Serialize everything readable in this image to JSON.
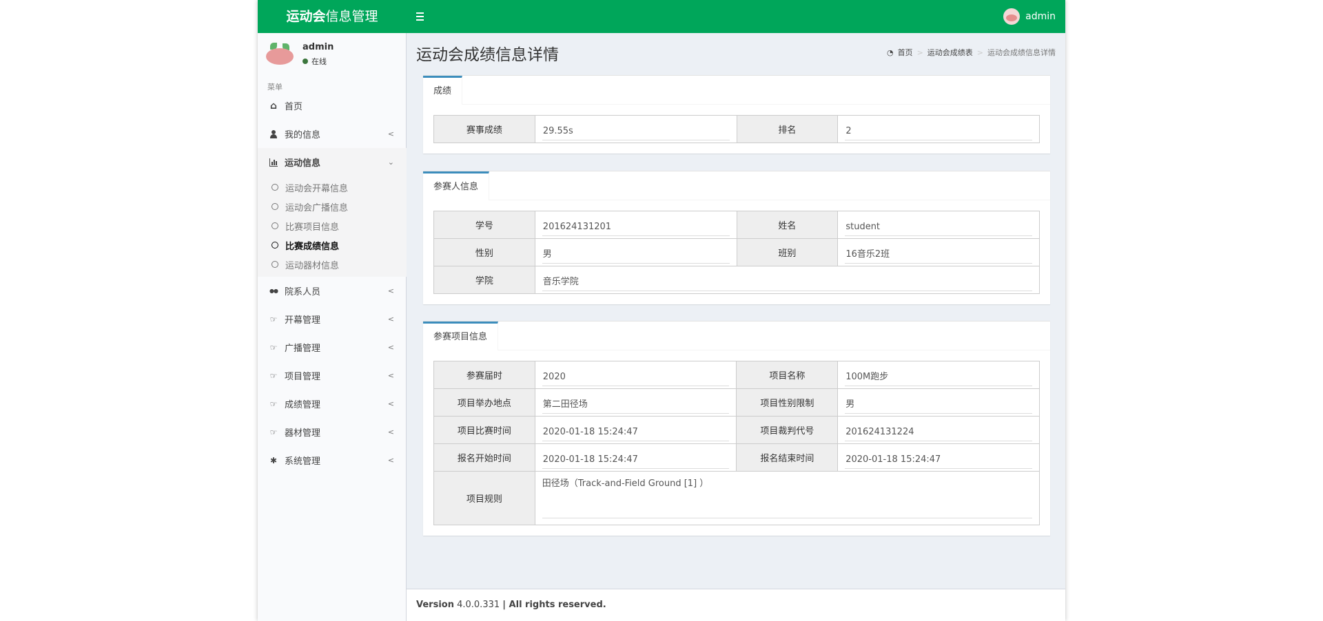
{
  "header": {
    "logo_bold": "运动会",
    "logo_rest": "信息管理",
    "user": "admin"
  },
  "sidebar": {
    "user_name": "admin",
    "user_status": "在线",
    "menu_header": "菜单",
    "items": [
      {
        "label": "首页",
        "icon": "home-icon"
      },
      {
        "label": "我的信息",
        "icon": "user-icon"
      },
      {
        "label": "运动信息",
        "icon": "bar-chart-icon"
      },
      {
        "label": "院系人员",
        "icon": "users-icon"
      },
      {
        "label": "开幕管理",
        "icon": "thumb-icon"
      },
      {
        "label": "广播管理",
        "icon": "thumb-icon"
      },
      {
        "label": "项目管理",
        "icon": "thumb-icon"
      },
      {
        "label": "成绩管理",
        "icon": "thumb-icon"
      },
      {
        "label": "器材管理",
        "icon": "thumb-icon"
      },
      {
        "label": "系统管理",
        "icon": "gear-icon"
      }
    ],
    "submenu": [
      {
        "label": "运动会开幕信息"
      },
      {
        "label": "运动会广播信息"
      },
      {
        "label": "比赛项目信息"
      },
      {
        "label": "比赛成绩信息"
      },
      {
        "label": "运动器材信息"
      }
    ]
  },
  "page": {
    "title": "运动会成绩信息详情",
    "breadcrumb": [
      "首页",
      "运动会成绩表",
      "运动会成绩信息详情"
    ]
  },
  "score_box": {
    "tab": "成绩",
    "rows": [
      [
        {
          "label": "赛事成绩",
          "value": "29.55s"
        },
        {
          "label": "排名",
          "value": "2"
        }
      ]
    ]
  },
  "participant_box": {
    "tab": "参赛人信息",
    "rows": [
      [
        {
          "label": "学号",
          "value": "201624131201"
        },
        {
          "label": "姓名",
          "value": "student"
        }
      ],
      [
        {
          "label": "性别",
          "value": "男"
        },
        {
          "label": "班别",
          "value": "16音乐2班"
        }
      ]
    ],
    "college_label": "学院",
    "college_value": "音乐学院"
  },
  "event_box": {
    "tab": "参赛项目信息",
    "rows": [
      [
        {
          "label": "参赛届时",
          "value": "2020"
        },
        {
          "label": "项目名称",
          "value": "100M跑步"
        }
      ],
      [
        {
          "label": "项目举办地点",
          "value": "第二田径场"
        },
        {
          "label": "项目性别限制",
          "value": "男"
        }
      ],
      [
        {
          "label": "项目比赛时间",
          "value": "2020-01-18 15:24:47"
        },
        {
          "label": "项目裁判代号",
          "value": "201624131224"
        }
      ],
      [
        {
          "label": "报名开始时间",
          "value": "2020-01-18 15:24:47"
        },
        {
          "label": "报名结束时间",
          "value": "2020-01-18 15:24:47"
        }
      ]
    ],
    "rules_label": "项目规则",
    "rules_value": "田径场（Track-and-Field Ground [1] ）"
  },
  "footer": {
    "version_label": "Version",
    "version": "4.0.0.331",
    "rights": "| All rights reserved."
  }
}
